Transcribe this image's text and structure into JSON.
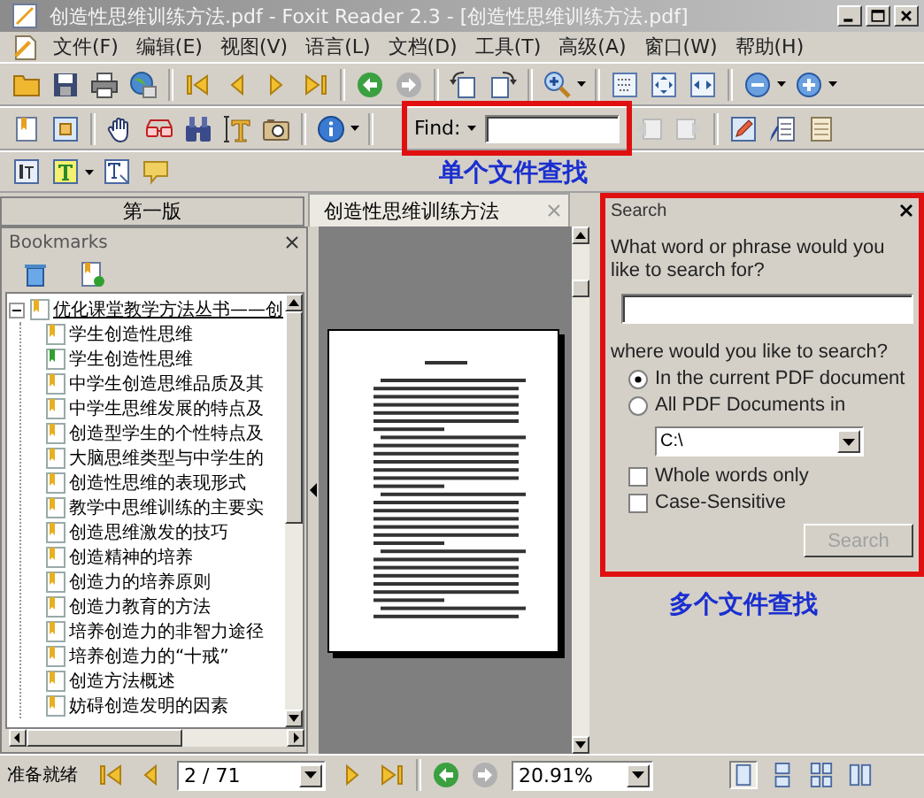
{
  "window": {
    "title": "创造性思维训练方法.pdf - Foxit Reader 2.3 - [创造性思维训练方法.pdf]"
  },
  "menu": [
    {
      "label": "文件(F)"
    },
    {
      "label": "编辑(E)"
    },
    {
      "label": "视图(V)"
    },
    {
      "label": "语言(L)"
    },
    {
      "label": "文档(D)"
    },
    {
      "label": "工具(T)"
    },
    {
      "label": "高级(A)"
    },
    {
      "label": "窗口(W)"
    },
    {
      "label": "帮助(H)"
    }
  ],
  "find_bar": {
    "label": "Find:"
  },
  "annotations": [
    {
      "text": "单个文件查找"
    },
    {
      "text": "多个文件查找"
    }
  ],
  "tabs": [
    {
      "label": "第一版",
      "selected": false
    },
    {
      "label": "创造性思维训练方法",
      "selected": true
    }
  ],
  "bookmarks": {
    "title": "Bookmarks",
    "tree": [
      {
        "label": "优化课堂教学方法丛书——创",
        "color": "#e8b020",
        "expanded": true,
        "children": [
          {
            "label": "学生创造性思维",
            "color": "#e8b020"
          },
          {
            "label": "学生创造性思维",
            "color": "#30a030"
          },
          {
            "label": "中学生创造思维品质及其",
            "color": "#e8b020"
          },
          {
            "label": "中学生思维发展的特点及",
            "color": "#e8b020"
          },
          {
            "label": "创造型学生的个性特点及",
            "color": "#e8b020"
          },
          {
            "label": "大脑思维类型与中学生的",
            "color": "#e8b020"
          },
          {
            "label": "创造性思维的表现形式",
            "color": "#e8b020"
          },
          {
            "label": "教学中思维训练的主要实",
            "color": "#e8b020"
          },
          {
            "label": "创造思维激发的技巧",
            "color": "#e8b020"
          },
          {
            "label": "创造精神的培养",
            "color": "#e8b020"
          },
          {
            "label": "创造力的培养原则",
            "color": "#e8b020"
          },
          {
            "label": "创造力教育的方法",
            "color": "#e8b020"
          },
          {
            "label": "培养创造力的非智力途径",
            "color": "#e8b020"
          },
          {
            "label": "培养创造力的“十戒”",
            "color": "#e8b020"
          },
          {
            "label": "创造方法概述",
            "color": "#e8b020"
          },
          {
            "label": "妨碍创造发明的因素",
            "color": "#e8b020"
          }
        ]
      }
    ]
  },
  "search_panel": {
    "title": "Search",
    "question": "What word or phrase would you like to search for?",
    "where_label": "where would you like to search?",
    "scope": [
      {
        "label": "In the current PDF document",
        "selected": true
      },
      {
        "label": "All PDF Documents in",
        "selected": false
      }
    ],
    "folder": "C:\\",
    "options": [
      {
        "label": "Whole words only",
        "checked": false
      },
      {
        "label": "Case-Sensitive",
        "checked": false
      }
    ],
    "button": {
      "label": "Search",
      "disabled": true
    }
  },
  "status_bar": {
    "message": "准备就绪",
    "page": "2 / 71",
    "zoom": "20.91%",
    "view_modes": [
      {
        "selected": true
      },
      {
        "selected": false
      },
      {
        "selected": false
      },
      {
        "selected": false
      }
    ]
  }
}
